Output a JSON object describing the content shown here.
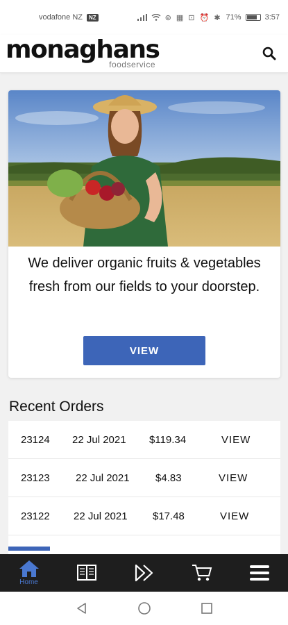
{
  "status_bar": {
    "carrier": "vodafone NZ",
    "network_badge": "NZ",
    "status_icons": "⊚ ▦ ⊡ ⏰ ✱",
    "battery_percent": "71%",
    "time": "3:57"
  },
  "header": {
    "logo_main": "monaghans",
    "logo_sub": "foodservice",
    "search_icon": "search-icon"
  },
  "hero": {
    "text": "We deliver organic fruits & vegetables fresh from our fields to your doorstep.",
    "button_label": "VIEW"
  },
  "orders": {
    "title": "Recent Orders",
    "rows": [
      {
        "id": "23124",
        "date": "22 Jul 2021",
        "total": "$119.34",
        "action": "VIEW"
      },
      {
        "id": "23123",
        "date": "22 Jul 2021",
        "total": "$4.83",
        "action": "VIEW"
      },
      {
        "id": "23122",
        "date": "22 Jul 2021",
        "total": "$17.48",
        "action": "VIEW"
      }
    ]
  },
  "bottom_nav": {
    "items": [
      {
        "icon": "home-icon",
        "label": "Home",
        "active": true
      },
      {
        "icon": "catalog-book-icon",
        "label": ""
      },
      {
        "icon": "fast-forward-icon",
        "label": ""
      },
      {
        "icon": "cart-icon",
        "label": ""
      },
      {
        "icon": "menu-icon",
        "label": ""
      }
    ]
  },
  "colors": {
    "accent": "#3d65b8",
    "nav_background": "#1e1e1e",
    "active_nav": "#4a78d0"
  }
}
